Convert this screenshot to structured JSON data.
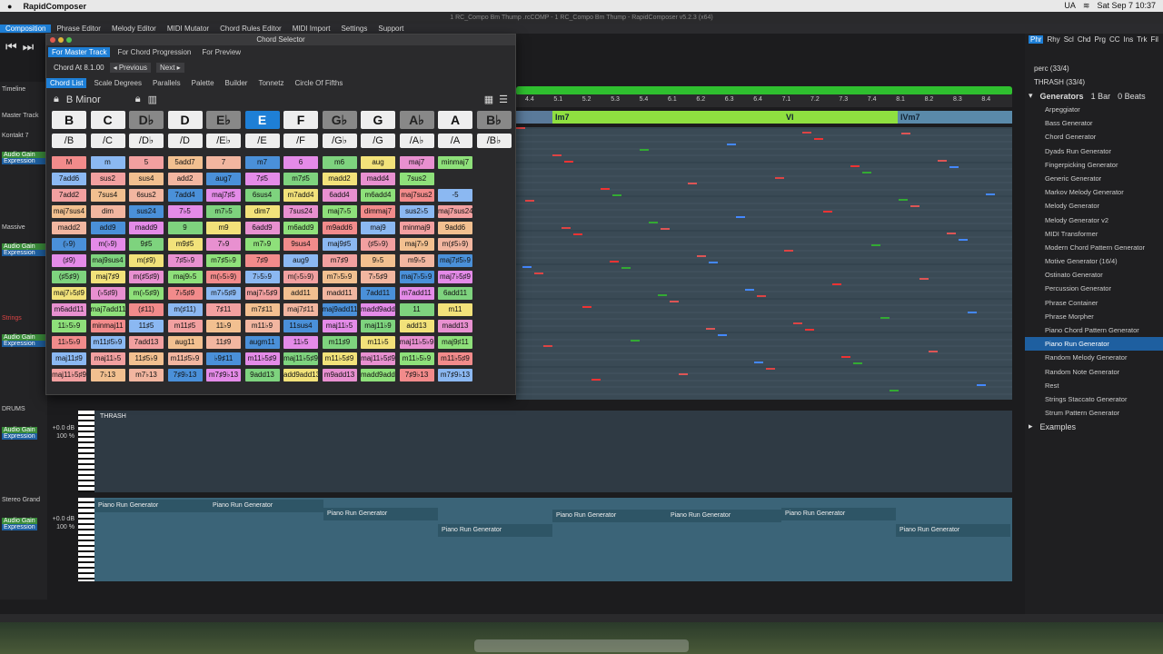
{
  "mac": {
    "app": "RapidComposer",
    "time": "Sat Sep 7  10:37",
    "flag": "UA"
  },
  "window_title": "1 RC_Compo Bm Thump .rcCOMP - 1 RC_Compo Bm Thump - RapidComposer v5.2.3 (x64)",
  "menu": [
    "Composition",
    "Phrase Editor",
    "Melody Editor",
    "MIDI Mutator",
    "Chord Rules Editor",
    "MIDI Import",
    "Settings",
    "Support"
  ],
  "left": {
    "timeline": "Timeline",
    "master": "Master Track",
    "tracks": [
      {
        "name": "Kontakt 7",
        "gain": "Audio Gain",
        "exp": "Expression"
      },
      {
        "name": "Massive",
        "gain": "Audio Gain",
        "exp": "Expression"
      },
      {
        "name": "Strings",
        "gain": "Audio Gain",
        "exp": "Expression"
      },
      {
        "name": "DRUMS",
        "gain": "Audio Gain",
        "gainv": "+0.0 dB",
        "exp": "Expression",
        "expv": "100 %"
      },
      {
        "name": "Stereo Grand",
        "gain": "Audio Gain",
        "gainv": "+0.0 dB",
        "exp": "Expression",
        "expv": "100 %"
      }
    ]
  },
  "ruler": [
    "4.4",
    "5.1",
    "5.2",
    "5.3",
    "5.4",
    "6.1",
    "6.2",
    "6.3",
    "6.4",
    "7.1",
    "7.2",
    "7.3",
    "7.4",
    "8.1",
    "8.2",
    "8.3",
    "8.4"
  ],
  "chords": [
    {
      "label": "Im7",
      "color": "#8fe040"
    },
    {
      "label": "VI",
      "color": "#8fe040"
    },
    {
      "label": "IVm7",
      "color": "#5a8aaa"
    }
  ],
  "drums_clip": "THRASH",
  "piano_clips": [
    "Piano Run Generator",
    "Piano Run Generator",
    "Piano Run Generator",
    "Piano Run Generator",
    "Piano Run Generator",
    "Piano Run Generator",
    "Piano Run Generator",
    "Piano Run Generator"
  ],
  "right": {
    "tabs": [
      "Phr",
      "Rhy",
      "Scl",
      "Chd",
      "Prg",
      "CC",
      "Ins",
      "Trk",
      "Fil"
    ],
    "perc": "perc  (33/4)",
    "thrash": "THRASH  (33/4)",
    "gen_title": "Generators",
    "bar": "1 Bar",
    "beats": "0 Beats",
    "generators": [
      "Arpeggiator",
      "Bass Generator",
      "Chord Generator",
      "Dyads Run Generator",
      "Fingerpicking Generator",
      "Generic Generator",
      "Markov Melody Generator",
      "Melody Generator",
      "Melody Generator v2",
      "MIDI Transformer",
      "Modern Chord Pattern Generator",
      "Motive Generator  (16/4)",
      "Ostinato Generator",
      "Percussion Generator",
      "Phrase Container",
      "Phrase Morpher",
      "Piano Chord Pattern Generator",
      "Piano Run Generator",
      "Random Melody Generator",
      "Random Note Generator",
      "Rest",
      "Strings Staccato Generator",
      "Strum Pattern Generator"
    ],
    "selected_generator": "Piano Run Generator",
    "examples": "Examples"
  },
  "dialog": {
    "title": "Chord Selector",
    "tabs": [
      "For Master Track",
      "For Chord Progression",
      "For Preview"
    ],
    "chord_at": "Chord At 8.1.00",
    "prev": "◂ Previous",
    "next": "Next ▸",
    "subtabs": [
      "Chord List",
      "Scale Degrees",
      "Parallels",
      "Palette",
      "Builder",
      "Tonnetz",
      "Circle Of Fifths"
    ],
    "key": "B Minor",
    "roots": [
      "B",
      "C",
      "D♭",
      "D",
      "E♭",
      "E",
      "F",
      "G♭",
      "G",
      "A♭",
      "A",
      "B♭"
    ],
    "selected_root": "E",
    "slashes": [
      "/B",
      "/C",
      "/D♭",
      "/D",
      "/E♭",
      "/E",
      "/F",
      "/G♭",
      "/G",
      "/A♭",
      "/A",
      "/B♭"
    ],
    "qualities": [
      [
        "M",
        "m",
        "5",
        "5add7",
        "7",
        "m7",
        "6",
        "m6",
        "aug",
        "maj7",
        "minmaj7"
      ],
      [
        "7add6",
        "sus2",
        "sus4",
        "add2",
        "aug7",
        "7♯5",
        "m7♯5",
        "madd2",
        "madd4",
        "7sus2",
        ""
      ],
      [
        "7add2",
        "7sus4",
        "6sus2",
        "7add4",
        "maj7♯5",
        "6sus4",
        "m7add4",
        "6add4",
        "m6add4",
        "maj7sus2",
        "-5"
      ],
      [
        "maj7sus4",
        "dim",
        "sus24",
        "7♭5",
        "m7♭5",
        "dim7",
        "7sus24",
        "maj7♭5",
        "dimmaj7",
        "sus2♭5",
        "maj7sus24"
      ],
      [
        "madd2",
        "add9",
        "madd9",
        "9",
        "m9",
        "6add9",
        "m6add9",
        "m9add6",
        "maj9",
        "minmaj9",
        "9add6"
      ],
      [
        "(♭9)",
        "m(♭9)",
        "9♯5",
        "m9♯5",
        "7♭9",
        "m7♭9",
        "9sus4",
        "maj9♯5",
        "(♯5♭9)",
        "maj7♭9",
        "m(♯5♭9)"
      ],
      [
        "(♯9)",
        "maj9sus4",
        "m(♯9)",
        "7♯5♭9",
        "m7♯5♭9",
        "7♯9",
        "aug9",
        "m7♯9",
        "9♭5",
        "m9♭5",
        "maj7♯5♭9"
      ],
      [
        "(♯5♯9)",
        "maj7♯9",
        "m(♯5♯9)",
        "maj9♭5",
        "m(♭5♭9)",
        "7♭5♭9",
        "m(♭5♭9)",
        "m7♭5♭9",
        "7♭5♯9",
        "maj7♭5♭9",
        "maj7♭5♯9"
      ],
      [
        "maj7♭5♯9",
        "(♭5♯9)",
        "m(♭5♯9)",
        "7♭5♯9",
        "m7♭5♯9",
        "maj7♭5♯9",
        "add11",
        "madd11",
        "7add11",
        "m7add11",
        "6add11"
      ],
      [
        "m6add11",
        "maj7add11",
        "(♯11)",
        "m(♯11)",
        "7♯11",
        "m7♯11",
        "maj7♯11",
        "maj9add11",
        "madd9add11",
        "11",
        "m11"
      ],
      [
        "11♭5♭9",
        "minmaj11",
        "11♯5",
        "m11♯5",
        "11♭9",
        "m11♭9",
        "11sus4",
        "maj11♭5",
        "maj11♭9",
        "add13",
        "madd13"
      ],
      [
        "11♭5♭9",
        "m11♯5♭9",
        "7add13",
        "aug11",
        "11♯9",
        "augm11",
        "11♭5",
        "m11♯9",
        "m11♭5",
        "maj11♭5♭9",
        "maj9♯11"
      ],
      [
        "maj11♯9",
        "maj11♭5",
        "11♯5♭9",
        "m11♯5♭9",
        "♭9♯11",
        "m11♭5♯9",
        "maj11♭5♯9",
        "m11♭5♯9",
        "maj11♭5♯9",
        "m11♭5♭9",
        "m11♭5♯9"
      ],
      [
        "maj11♭5♯9",
        "7♭13",
        "m7♭13",
        "7♯9♭13",
        "m7♯9♭13",
        "9add13",
        "add9add13",
        "m9add13",
        "madd9add13",
        "7♯9♭13",
        "m7♯9♭13"
      ]
    ]
  },
  "colors": {
    "accent": "#1e7fd6",
    "timeline": "#2fbf2f",
    "chord_green": "#8fe040"
  }
}
